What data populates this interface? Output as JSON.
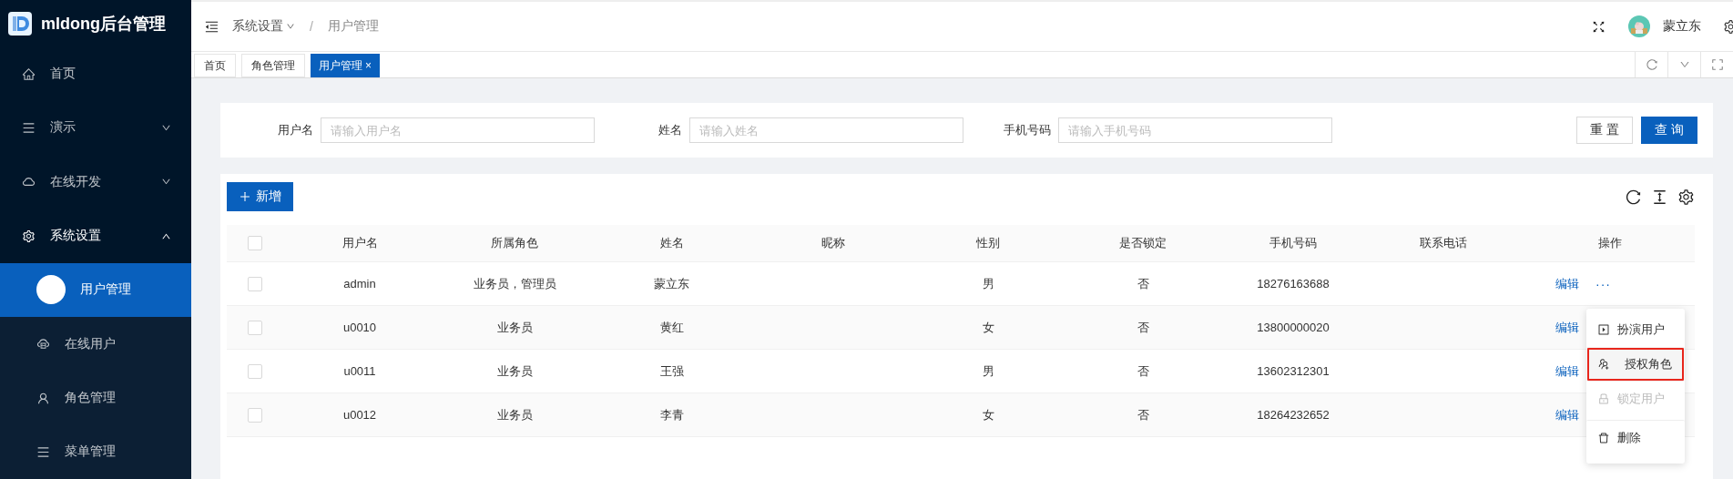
{
  "sidebar": {
    "title": "mldong后台管理",
    "items": [
      {
        "label": "首页"
      },
      {
        "label": "演示",
        "expanded": false
      },
      {
        "label": "在线开发",
        "expanded": false
      },
      {
        "label": "系统设置",
        "expanded": true,
        "children": [
          {
            "label": "用户管理",
            "selected": true
          },
          {
            "label": "在线用户",
            "selected": false
          },
          {
            "label": "角色管理",
            "selected": false
          },
          {
            "label": "菜单管理",
            "selected": false
          }
        ]
      }
    ]
  },
  "header": {
    "breadcrumb": [
      "系统设置",
      "用户管理"
    ],
    "separator": "/",
    "user": "蒙立东"
  },
  "tabs": [
    {
      "label": "首页",
      "selected": false
    },
    {
      "label": "角色管理",
      "selected": false
    },
    {
      "label": "用户管理",
      "selected": true,
      "close": "×"
    }
  ],
  "search": {
    "fields": [
      {
        "label": "用户名",
        "placeholder": "请输入用户名"
      },
      {
        "label": "姓名",
        "placeholder": "请输入姓名"
      },
      {
        "label": "手机号码",
        "placeholder": "请输入手机号码"
      }
    ],
    "buttons": [
      {
        "label": "重 置",
        "kind": "default"
      },
      {
        "label": "查 询",
        "kind": "primary"
      }
    ]
  },
  "toolbar": {
    "add": "新增"
  },
  "table": {
    "select_all_checked": false,
    "columns": [
      "用户名",
      "所属角色",
      "姓名",
      "昵称",
      "性别",
      "是否锁定",
      "手机号码",
      "联系电话",
      "操作"
    ],
    "rows": [
      {
        "checked": false,
        "cells": [
          "admin",
          "业务员，管理员",
          "蒙立东",
          "",
          "男",
          "否",
          "18276163688",
          ""
        ],
        "action": "编辑",
        "more": "···"
      },
      {
        "checked": false,
        "cells": [
          "u0010",
          "业务员",
          "黄红",
          "",
          "女",
          "否",
          "13800000020",
          ""
        ],
        "action": "编辑"
      },
      {
        "checked": false,
        "cells": [
          "u0011",
          "业务员",
          "王强",
          "",
          "男",
          "否",
          "13602312301",
          ""
        ],
        "action": "编辑"
      },
      {
        "checked": false,
        "cells": [
          "u0012",
          "业务员",
          "李青",
          "",
          "女",
          "否",
          "18264232652",
          ""
        ],
        "action": "编辑"
      }
    ]
  },
  "dropdown": {
    "items": [
      {
        "label": "扮演用户",
        "disabled": false,
        "highlighted": false
      },
      {
        "label": "授权角色",
        "disabled": false,
        "highlighted": true
      },
      {
        "label": "锁定用户",
        "disabled": true,
        "highlighted": false
      },
      {
        "label": "删除",
        "disabled": false,
        "highlighted": false,
        "divider_before": true
      }
    ]
  }
}
